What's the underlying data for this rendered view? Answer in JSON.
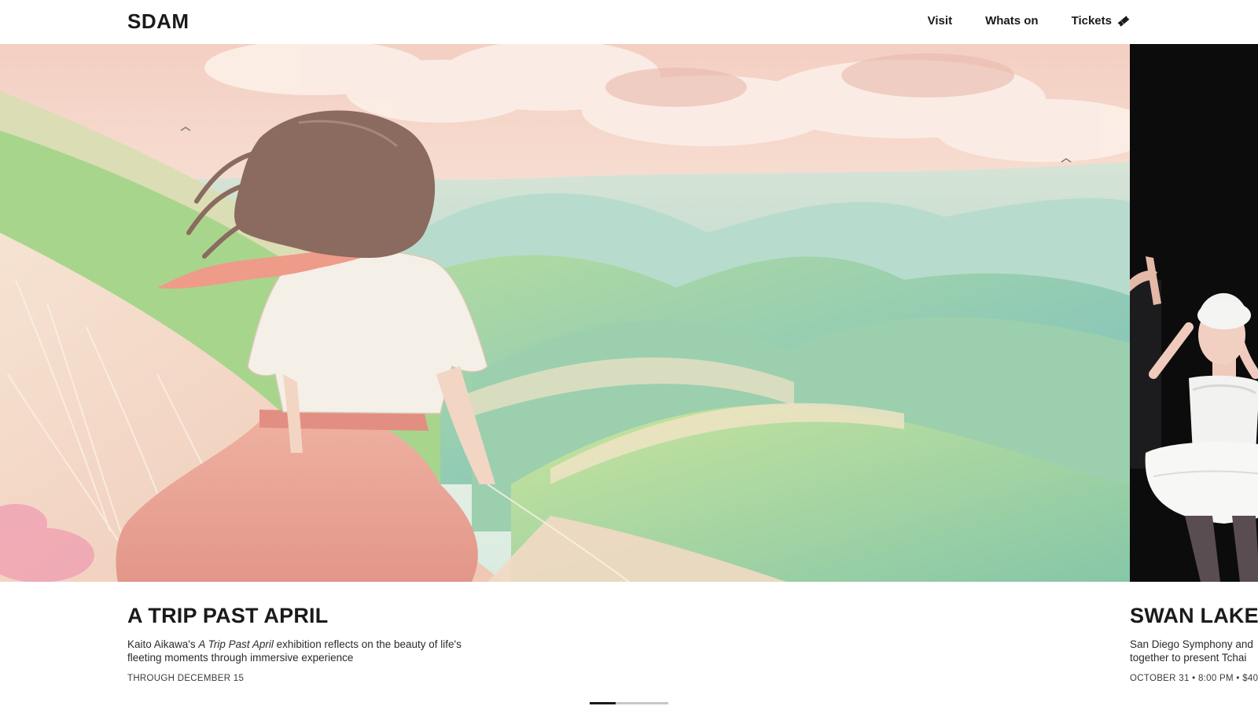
{
  "header": {
    "logo": "SDAM",
    "nav": [
      {
        "label": "Visit"
      },
      {
        "label": "Whats on"
      },
      {
        "label": "Tickets",
        "icon": "ticket-icon"
      }
    ]
  },
  "slides": [
    {
      "title": "A TRIP PAST APRIL",
      "description_prefix": "Kaito Aikawa's ",
      "description_emphasis": "A Trip Past April",
      "description_suffix": " exhibition reflects on the beauty of life's fleeting moments through immersive experience",
      "meta": "THROUGH DECEMBER 15"
    },
    {
      "title": "SWAN LAKE",
      "description_line1": "San Diego Symphony and",
      "description_line2": "together to present Tchai",
      "meta": "OCTOBER 31 • 8:00 PM • $40"
    }
  ],
  "pager": {
    "total": 3,
    "current": 1
  },
  "colors": {
    "text": "#1a1a1a",
    "pager_track": "#c8c8c8",
    "pager_active": "#1a1a1a",
    "sky": "#f6d9cf",
    "hill_green": "#9fcf98",
    "hill_teal": "#8cc6bd",
    "skirt": "#e8a393"
  }
}
